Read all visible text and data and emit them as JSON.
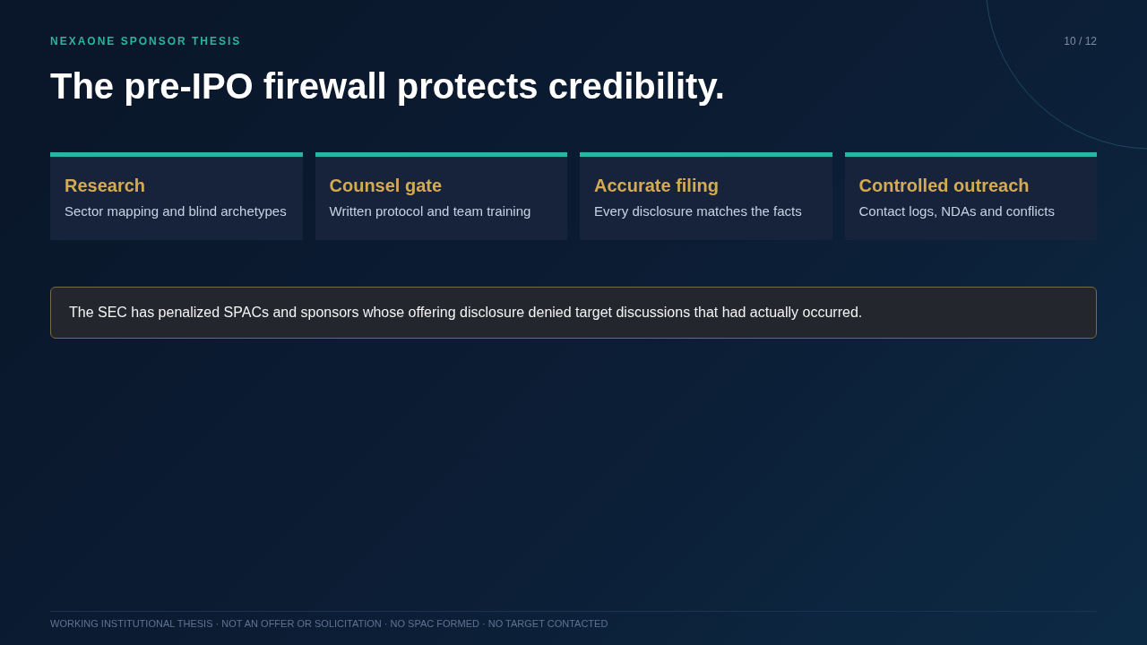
{
  "header": {
    "eyebrow": "NEXAONE SPONSOR THESIS",
    "page_number": "10 / 12"
  },
  "title": "The pre-IPO firewall protects credibility.",
  "cards": [
    {
      "title": "Research",
      "description": "Sector mapping and blind archetypes"
    },
    {
      "title": "Counsel gate",
      "description": "Written protocol and team training"
    },
    {
      "title": "Accurate filing",
      "description": "Every disclosure matches the facts"
    },
    {
      "title": "Controlled outreach",
      "description": "Contact logs, NDAs and conflicts"
    }
  ],
  "callout": {
    "text": "The SEC has penalized SPACs and sponsors whose offering disclosure denied target discussions that had actually occurred."
  },
  "footer": {
    "text": "WORKING INSTITUTIONAL THESIS · NOT AN OFFER OR SOLICITATION · NO SPAC FORMED · NO TARGET CONTACTED"
  }
}
